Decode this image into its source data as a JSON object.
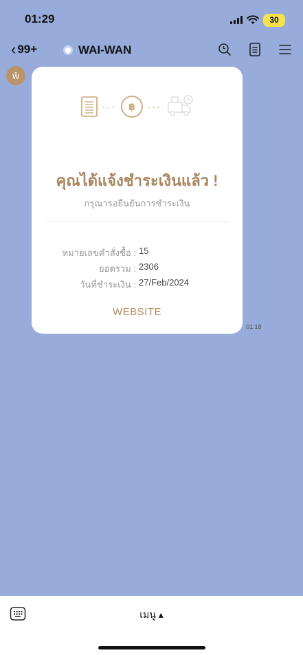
{
  "status_bar": {
    "time": "01:29",
    "battery": "30"
  },
  "header": {
    "back_label": "99+",
    "chat_name": "WAI-WAN"
  },
  "avatar": {
    "glyph": "ŵ"
  },
  "card": {
    "title": "คุณได้แจ้งชำระเงินแล้ว !",
    "subtitle": "กรุณารอยืนยันการชำระเงิน",
    "rows": [
      {
        "label": "หมายเลขคำสั่งซื้อ :",
        "value": "15"
      },
      {
        "label": "ยอดรวม :",
        "value": "2306"
      },
      {
        "label": "วันที่ชำระเงิน :",
        "value": "27/Feb/2024"
      }
    ],
    "website_label": "WEBSITE",
    "icon_colors": {
      "accent": "#C9A676"
    }
  },
  "message_time": "01:18",
  "bottom_bar": {
    "menu_label": "เมนู ▴"
  }
}
